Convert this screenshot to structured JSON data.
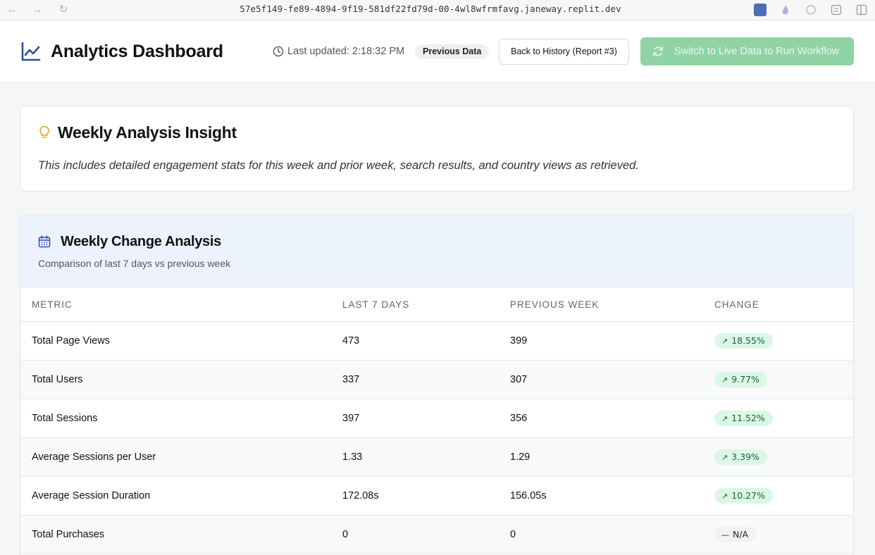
{
  "browser": {
    "url": "57e5f149-fe89-4894-9f19-581df22fd79d-00-4wl8wfrmfavg.janeway.replit.dev",
    "back_icon": "arrow-left-icon",
    "forward_icon": "arrow-right-icon",
    "reload_icon": "reload-icon"
  },
  "header": {
    "title": "Analytics Dashboard",
    "last_updated": "Last updated: 2:18:32 PM",
    "data_badge": "Previous Data",
    "back_button": "Back to History (Report #3)",
    "live_button": "Switch to Live Data to Run Workflow",
    "accent_color": "#2b4ea2",
    "live_button_color": "#90d4a6"
  },
  "insight": {
    "title": "Weekly Analysis Insight",
    "text": "This includes detailed engagement stats for this week and prior week, search results, and country views as retrieved."
  },
  "weekly": {
    "title": "Weekly Change Analysis",
    "subtitle": "Comparison of last 7 days vs previous week",
    "columns": [
      "METRIC",
      "LAST 7 DAYS",
      "PREVIOUS WEEK",
      "CHANGE"
    ],
    "rows": [
      {
        "metric": "Total Page Views",
        "last": "473",
        "previous": "399",
        "change": "18.55%",
        "trend": "up"
      },
      {
        "metric": "Total Users",
        "last": "337",
        "previous": "307",
        "change": "9.77%",
        "trend": "up"
      },
      {
        "metric": "Total Sessions",
        "last": "397",
        "previous": "356",
        "change": "11.52%",
        "trend": "up"
      },
      {
        "metric": "Average Sessions per User",
        "last": "1.33",
        "previous": "1.29",
        "change": "3.39%",
        "trend": "up"
      },
      {
        "metric": "Average Session Duration",
        "last": "172.08s",
        "previous": "156.05s",
        "change": "10.27%",
        "trend": "up"
      },
      {
        "metric": "Total Purchases",
        "last": "0",
        "previous": "0",
        "change": "N/A",
        "trend": "none"
      }
    ]
  }
}
